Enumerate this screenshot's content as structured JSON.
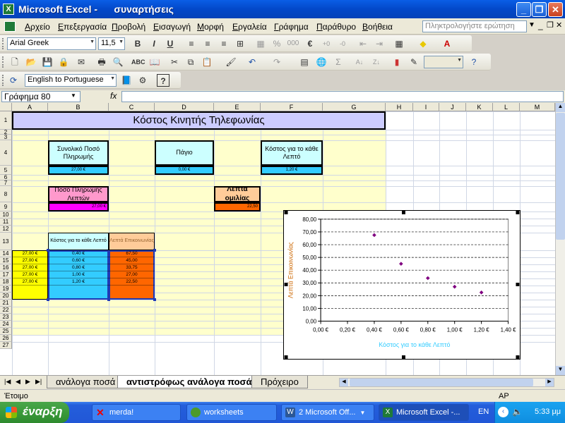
{
  "window": {
    "title": "Microsoft Excel -      συναρτήσεις",
    "icon": "excel-icon"
  },
  "menu": [
    "Αρχείο",
    "Επεξεργασία",
    "Προβολή",
    "Εισαγωγή",
    "Μορφή",
    "Εργαλεία",
    "Γράφημα",
    "Παράθυρο",
    "Βοήθεια"
  ],
  "ask_placeholder": "Πληκτρολογήστε ερώτηση",
  "format_toolbar": {
    "font": "Arial Greek",
    "size": "11,5",
    "bold": "B",
    "italic": "I",
    "underline": "U"
  },
  "translate_toolbar": {
    "language": "English to Portuguese"
  },
  "formula_bar": {
    "name_box": "Γράφημα 80",
    "fx": "fx"
  },
  "columns": [
    "A",
    "B",
    "C",
    "D",
    "E",
    "F",
    "G",
    "H",
    "I",
    "J",
    "K",
    "L",
    "M"
  ],
  "rows": [
    "1",
    "2",
    "3",
    "4",
    "5",
    "6",
    "7",
    "8",
    "9",
    "10",
    "11",
    "12",
    "13",
    "14",
    "15",
    "16",
    "17",
    "18",
    "19",
    "20",
    "21",
    "22",
    "23",
    "24",
    "25",
    "26",
    "27"
  ],
  "sheet": {
    "title": "Κόστος Κινητής Τηλεφωνίας",
    "total_label": "Συνολικό Ποσό Πληρωμής",
    "total_value": "27,00 €",
    "fee_label": "Πάγιο",
    "fee_value": "0,00 €",
    "cost_label": "Κόστος για το κάθε Λεπτό",
    "cost_value": "1,20 €",
    "minutes_label": "Λεπτά ομιλίας",
    "minutes_value": "22,50",
    "payment_label": "Ποσό Πληρωμής Λεπτών",
    "payment_value": "27,00 €",
    "table_header_cost": "Κόστος για το κάθε Λεπτό",
    "table_header_minutes": "Λεπτά Επικοινωνίας",
    "table_rows": [
      {
        "a": "27,00 €",
        "b": "0,40 €",
        "c": "67,50"
      },
      {
        "a": "27,00 €",
        "b": "0,60 €",
        "c": "45,00"
      },
      {
        "a": "27,00 €",
        "b": "0,80 €",
        "c": "33,75"
      },
      {
        "a": "27,00 €",
        "b": "1,00 €",
        "c": "27,00"
      },
      {
        "a": "27,00 €",
        "b": "1,20 €",
        "c": "22,50"
      }
    ]
  },
  "chart_data": {
    "type": "scatter",
    "title": "",
    "xlabel": "Κόστος για το κάθε Λεπτό",
    "ylabel": "Λεπτά Επικοινωνίας",
    "xlim": [
      0,
      1.4
    ],
    "ylim": [
      0,
      80
    ],
    "xticks": [
      "0,00 €",
      "0,20 €",
      "0,40 €",
      "0,60 €",
      "0,80 €",
      "1,00 €",
      "1,20 €",
      "1,40 €"
    ],
    "yticks": [
      "0,00",
      "10,00",
      "20,00",
      "30,00",
      "40,00",
      "50,00",
      "60,00",
      "70,00",
      "80,00"
    ],
    "x": [
      0.4,
      0.6,
      0.8,
      1.0,
      1.2
    ],
    "y": [
      67.5,
      45,
      33.75,
      27,
      22.5
    ],
    "grid": true,
    "point_color": "#800080",
    "xlabel_color": "#33ccff",
    "ylabel_color": "#cc6600"
  },
  "tabs": [
    "ανάλογα ποσά",
    "αντιστρόφως ανάλογα ποσά",
    "Πρόχειρο"
  ],
  "active_tab": "αντιστρόφως ανάλογα ποσά",
  "status": {
    "left": "Έτοιμο",
    "right": "AP"
  },
  "taskbar": {
    "start": "έναρξη",
    "tasks": [
      "merda!",
      "worksheets",
      "2 Microsoft Off...",
      "Microsoft Excel -..."
    ],
    "lang": "EN",
    "clock": "5:33 μμ"
  }
}
